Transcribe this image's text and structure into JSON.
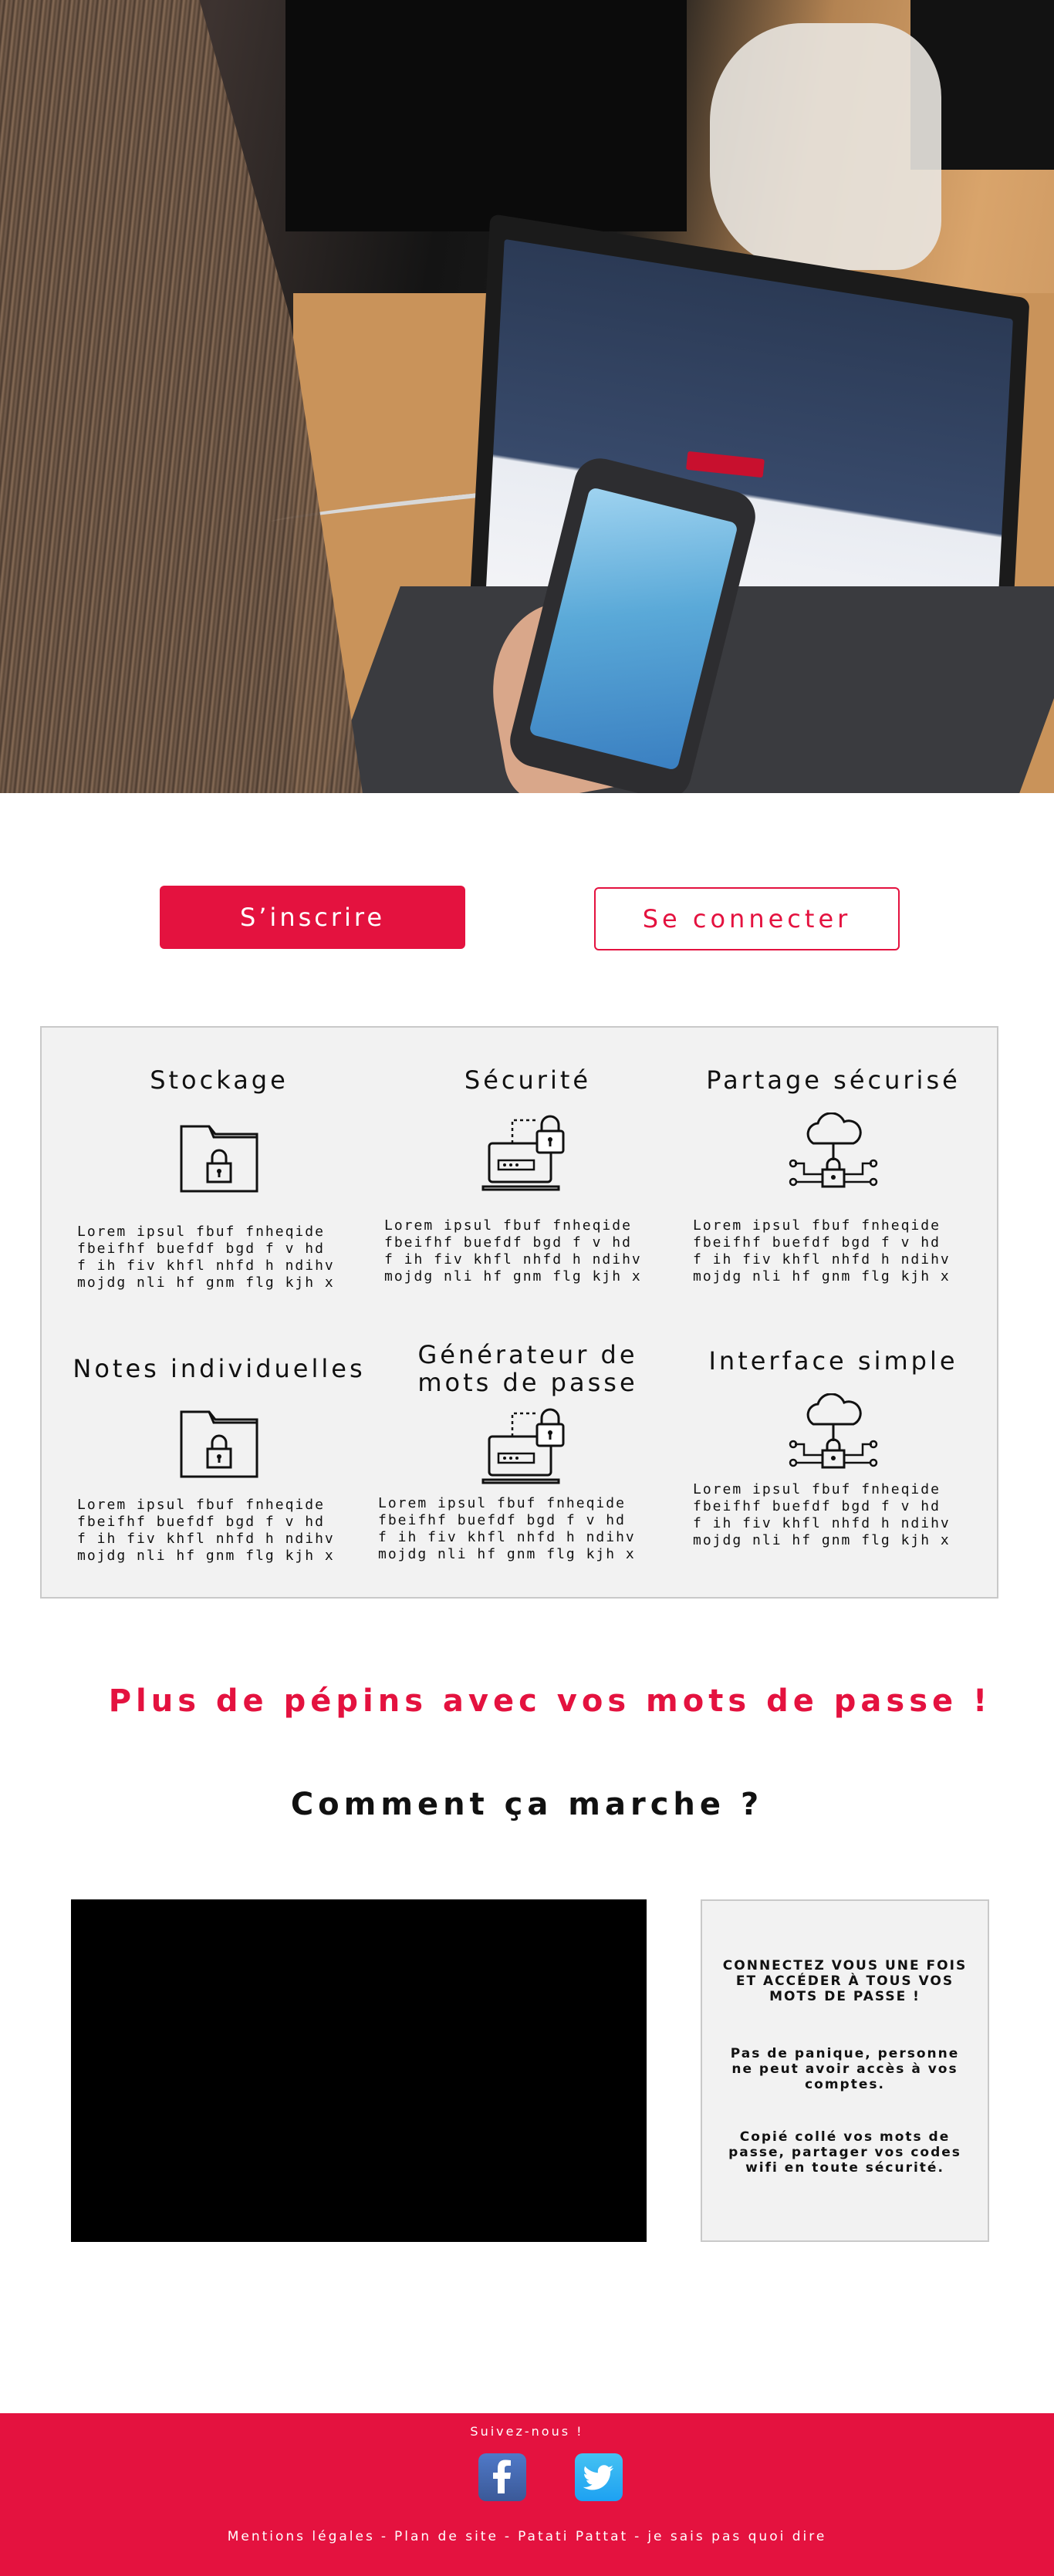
{
  "cta": {
    "signup_label": "S’inscrire",
    "login_label": "Se connecter"
  },
  "features": [
    {
      "title": "Stockage",
      "icon": "folder-lock-icon",
      "text": "Lorem ipsul fbuf fnheqide\nfbeifhf buefdf bgd f v hd\nf ih fiv khfl nhfd h  ndihv\nmojdg nli hf gnm flg kjh x"
    },
    {
      "title": "Sécurité",
      "icon": "laptop-lock-icon",
      "text": "Lorem ipsul fbuf fnheqide\nfbeifhf buefdf bgd f v hd\nf ih fiv khfl nhfd h  ndihv\nmojdg nli hf gnm flg kjh x"
    },
    {
      "title": "Partage sécurisé",
      "icon": "cloud-network-lock-icon",
      "text": "Lorem ipsul fbuf fnheqide\nfbeifhf buefdf bgd f v hd\nf ih fiv khfl nhfd h  ndihv\nmojdg nli hf gnm flg kjh x"
    },
    {
      "title": "Notes individuelles",
      "icon": "folder-lock-icon",
      "text": "Lorem ipsul fbuf fnheqide\nfbeifhf buefdf bgd f v hd\nf ih fiv khfl nhfd h  ndihv\nmojdg nli hf gnm flg kjh x"
    },
    {
      "title": "Générateur de\nmots de passe",
      "icon": "laptop-lock-icon",
      "text": "Lorem ipsul fbuf fnheqide\nfbeifhf buefdf bgd f v hd\nf ih fiv khfl nhfd h  ndihv\nmojdg nli hf gnm flg kjh x"
    },
    {
      "title": "Interface simple",
      "icon": "cloud-network-lock-icon",
      "text": "Lorem ipsul fbuf fnheqide\nfbeifhf buefdf bgd f v hd\nf ih fiv khfl nhfd h  ndihv\nmojdg nli hf gnm flg kjh x"
    }
  ],
  "tagline": "Plus de pépins avec vos mots de passe !",
  "how_title": "Comment ça marche ?",
  "info": {
    "line1": "CONNECTEZ VOUS UNE FOIS ET ACCÉDER À TOUS VOS MOTS DE PASSE !",
    "line2": "Pas de panique, personne ne peut avoir accès à vos comptes.",
    "line3": "Copié collé vos mots de passe, partager vos codes wifi en toute sécurité."
  },
  "footer": {
    "follow": "Suivez-nous !",
    "social": [
      {
        "name": "facebook",
        "icon": "facebook-icon",
        "color": "#3b5998"
      },
      {
        "name": "twitter",
        "icon": "twitter-icon",
        "color": "#1da1f2"
      }
    ],
    "links": [
      "Mentions légales",
      "Plan de site",
      "Patati Pattat",
      "je sais pas quoi dire"
    ],
    "separator": "-"
  },
  "colors": {
    "accent": "#e4123f",
    "panel_bg": "#f2f2f2",
    "panel_border": "#c9c9c9"
  }
}
